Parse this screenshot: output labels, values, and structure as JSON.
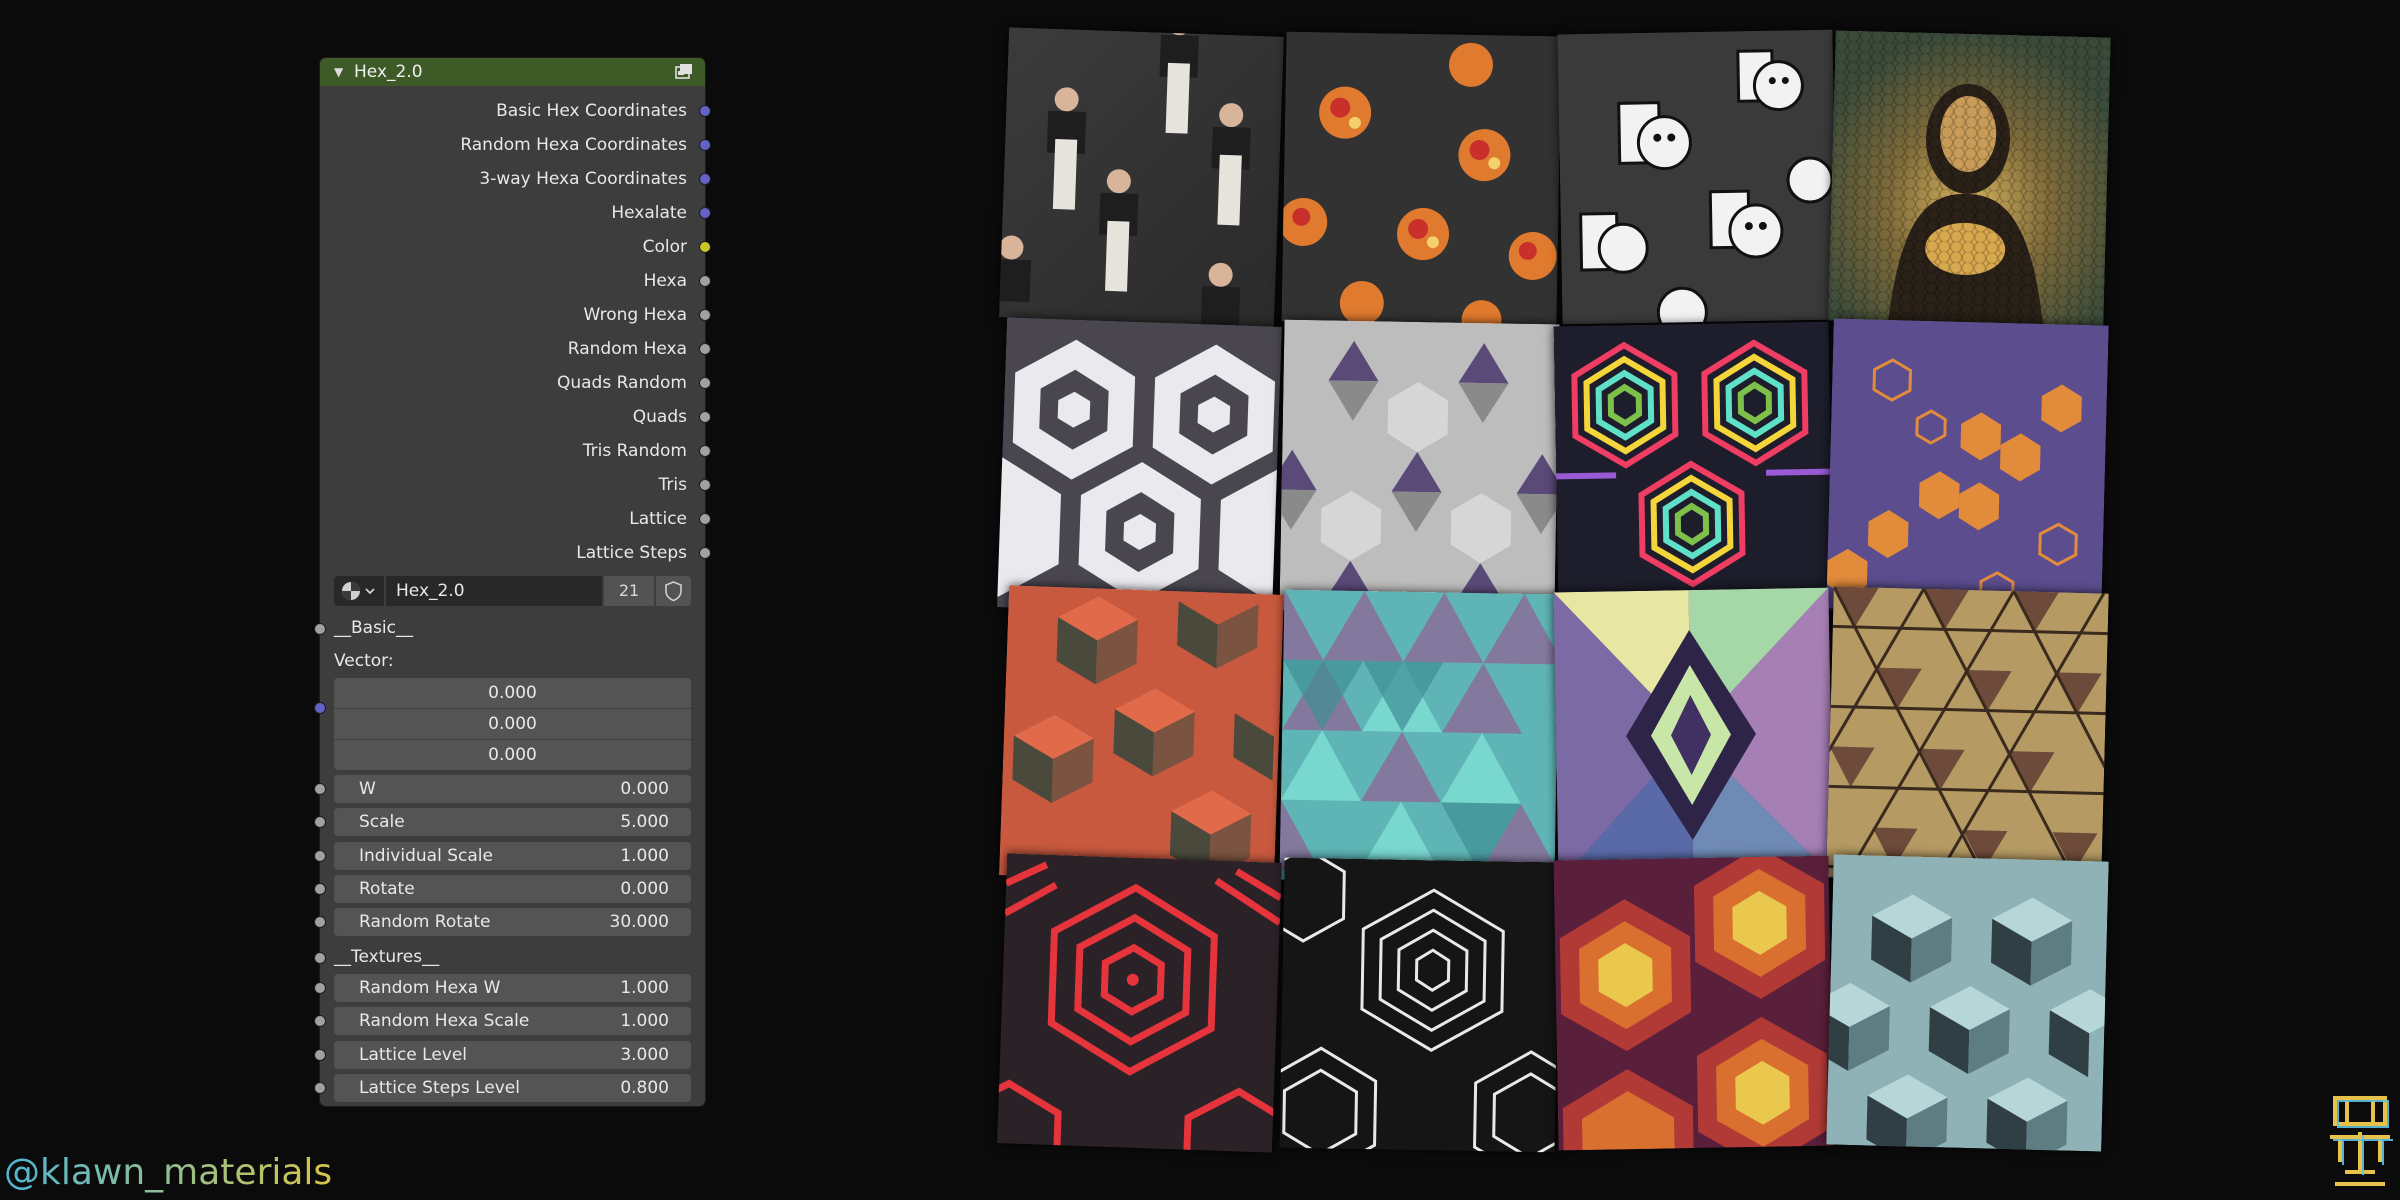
{
  "node": {
    "title": "Hex_2.0",
    "outputs": [
      {
        "label": "Basic Hex Coordinates",
        "socket": "blue"
      },
      {
        "label": "Random Hexa Coordinates",
        "socket": "blue"
      },
      {
        "label": "3-way Hexa Coordinates",
        "socket": "blue"
      },
      {
        "label": "Hexalate",
        "socket": "blue"
      },
      {
        "label": "Color",
        "socket": "yellow"
      },
      {
        "label": "Hexa",
        "socket": "grey"
      },
      {
        "label": "Wrong Hexa",
        "socket": "grey"
      },
      {
        "label": "Random Hexa",
        "socket": "grey"
      },
      {
        "label": "Quads Random",
        "socket": "grey"
      },
      {
        "label": "Quads",
        "socket": "grey"
      },
      {
        "label": "Tris Random",
        "socket": "grey"
      },
      {
        "label": "Tris",
        "socket": "grey"
      },
      {
        "label": "Lattice",
        "socket": "grey"
      },
      {
        "label": "Lattice Steps",
        "socket": "grey"
      }
    ],
    "group": {
      "name": "Hex_2.0",
      "users": "21"
    },
    "basic_label": "__Basic__",
    "vector_label": "Vector:",
    "vector_values": [
      "0.000",
      "0.000",
      "0.000"
    ],
    "inputs_basic": [
      {
        "label": "W",
        "value": "0.000"
      },
      {
        "label": "Scale",
        "value": "5.000"
      },
      {
        "label": "Individual Scale",
        "value": "1.000"
      },
      {
        "label": "Rotate",
        "value": "0.000"
      },
      {
        "label": "Random Rotate",
        "value": "30.000"
      }
    ],
    "textures_label": "__Textures__",
    "inputs_textures": [
      {
        "label": "Random Hexa W",
        "value": "1.000"
      },
      {
        "label": "Random Hexa Scale",
        "value": "1.000"
      },
      {
        "label": "Lattice Level",
        "value": "3.000"
      },
      {
        "label": "Lattice Steps Level",
        "value": "0.800"
      }
    ]
  },
  "colors": {
    "node_bg": "#3d3d3d",
    "header": "#3e5a26",
    "socket_vector": "#6363c7",
    "socket_color": "#c7c729",
    "socket_float": "#a1a1a1"
  },
  "previews": [
    {
      "name": "photo-cutout-tile",
      "icon": "person-pattern"
    },
    {
      "name": "food-pattern-tile",
      "icon": "food-pattern"
    },
    {
      "name": "cartoon-face-tile",
      "icon": "face-pattern"
    },
    {
      "name": "pixelated-portrait-tile",
      "icon": "hex-mosaic"
    },
    {
      "name": "hex-rings-white-tile",
      "icon": "hex-rings"
    },
    {
      "name": "star-of-david-grey-tile",
      "icon": "hexagram"
    },
    {
      "name": "rainbow-hex-lines-tile",
      "icon": "hex-lines"
    },
    {
      "name": "orange-hex-blobs-tile",
      "icon": "hex-blobs"
    },
    {
      "name": "red-cube-tile",
      "icon": "cubes"
    },
    {
      "name": "teal-triangles-tile",
      "icon": "triangles"
    },
    {
      "name": "purple-pyramids-tile",
      "icon": "pyramids"
    },
    {
      "name": "tan-lattice-tile",
      "icon": "lattice"
    },
    {
      "name": "red-concentric-hex-tile",
      "icon": "concentric-hex"
    },
    {
      "name": "white-concentric-hex-tile",
      "icon": "concentric-hex"
    },
    {
      "name": "fire-hex-steps-tile",
      "icon": "hex-steps"
    },
    {
      "name": "teal-cubes-tile",
      "icon": "cubes"
    }
  ],
  "watermark": "@klawn_materials"
}
